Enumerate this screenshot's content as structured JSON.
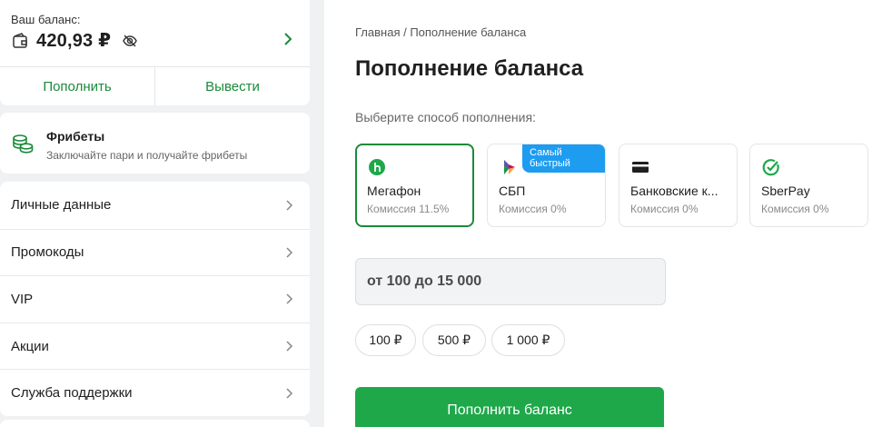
{
  "balance": {
    "label": "Ваш баланс:",
    "amount": "420,93 ₽",
    "topup_label": "Пополнить",
    "withdraw_label": "Вывести"
  },
  "freebets": {
    "title": "Фрибеты",
    "subtitle": "Заключайте пари и получайте фрибеты"
  },
  "menu": {
    "items": [
      {
        "label": "Личные данные"
      },
      {
        "label": "Промокоды"
      },
      {
        "label": "VIP"
      },
      {
        "label": "Акции"
      },
      {
        "label": "Служба поддержки"
      }
    ]
  },
  "main": {
    "breadcrumb": "Главная / Пополнение баланса",
    "title": "Пополнение баланса",
    "method_prompt": "Выберите способ пополнения:",
    "methods": [
      {
        "name": "Мегафон",
        "fee": "Комиссия 11.5%",
        "icon": "megafon-icon",
        "selected": true
      },
      {
        "name": "СБП",
        "fee": "Комиссия 0%",
        "icon": "sbp-icon",
        "badge": "Самый быстрый"
      },
      {
        "name": "Банковские к...",
        "fee": "Комиссия 0%",
        "icon": "bank-card-icon"
      },
      {
        "name": "SberPay",
        "fee": "Комиссия 0%",
        "icon": "sberpay-icon"
      }
    ],
    "amount_placeholder": "от 100 до 15 000",
    "chips": [
      "100 ₽",
      "500 ₽",
      "1 000 ₽"
    ],
    "submit_label": "Пополнить баланс"
  },
  "colors": {
    "accent_green": "#1a8a3a",
    "button_green": "#1ea84a",
    "badge_blue": "#1e9cf0"
  }
}
